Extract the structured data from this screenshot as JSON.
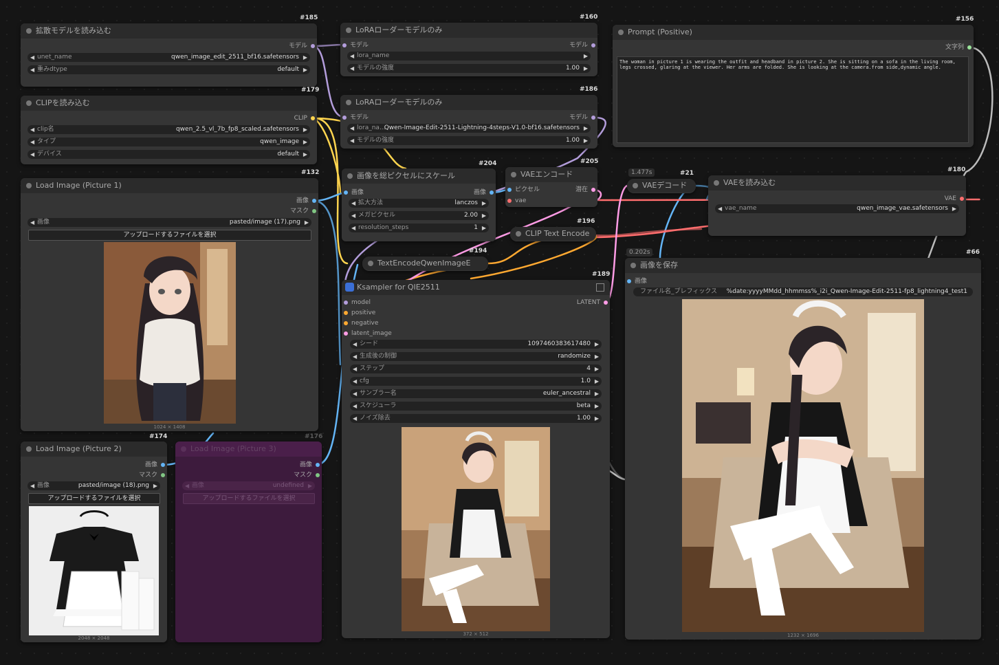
{
  "colors": {
    "model": "#b39ddb",
    "clip": "#ffd54f",
    "image": "#64b5f6",
    "mask": "#81c784",
    "latent": "#ff9ce6",
    "vae": "#ff6e6e",
    "conditioning": "#ffa931",
    "string": "#9be59b",
    "purple_node": "#3d1b3d"
  },
  "nodes": {
    "n185": {
      "id": "#185",
      "title": "拡散モデルを読み込む",
      "out": "モデル",
      "w1_label": "unet_name",
      "w1_value": "qwen_image_edit_2511_bf16.safetensors",
      "w2_label": "重みdtype",
      "w2_value": "default"
    },
    "n179": {
      "id": "#179",
      "title": "CLIPを読み込む",
      "out": "CLIP",
      "w1_label": "clip名",
      "w1_value": "qwen_2.5_vl_7b_fp8_scaled.safetensors",
      "w2_label": "タイプ",
      "w2_value": "qwen_image",
      "w3_label": "デバイス",
      "w3_value": "default"
    },
    "n132": {
      "id": "#132",
      "title": "Load Image (Picture 1)",
      "out1": "画像",
      "out2": "マスク",
      "w1_label": "画像",
      "w1_value": "pasted/image (17).png",
      "upload": "アップロードするファイルを選択",
      "dims": "1024 × 1408"
    },
    "n174": {
      "id": "#174",
      "title": "Load Image (Picture 2)",
      "out1": "画像",
      "out2": "マスク",
      "w1_label": "画像",
      "w1_value": "pasted/image (18).png",
      "upload": "アップロードするファイルを選択",
      "dims": "2048 × 2048"
    },
    "n176": {
      "id": "#176",
      "title": "Load Image (Picture 3)",
      "out1": "画像",
      "out2": "マスク",
      "w1_label": "画像",
      "w1_value": "undefined",
      "upload": "アップロードするファイルを選択"
    },
    "n160": {
      "id": "#160",
      "title": "LoRAローダーモデルのみ",
      "in": "モデル",
      "out": "モデル",
      "w1_label": "lora_name",
      "w1_value": "",
      "w2_label": "モデルの強度",
      "w2_value": "1.00"
    },
    "n186": {
      "id": "#186",
      "title": "LoRAローダーモデルのみ",
      "in": "モデル",
      "out": "モデル",
      "w1_label": "lora_na...",
      "w1_value": "Qwen-Image-Edit-2511-Lightning-4steps-V1.0-bf16.safetensors",
      "w2_label": "モデルの強度",
      "w2_value": "1.00"
    },
    "n204": {
      "id": "#204",
      "title": "画像を総ピクセルにスケール",
      "in": "画像",
      "out": "画像",
      "w1_label": "拡大方法",
      "w1_value": "lanczos",
      "w2_label": "メガピクセル",
      "w2_value": "2.00",
      "w3_label": "resolution_steps",
      "w3_value": "1"
    },
    "n205": {
      "id": "#205",
      "title": "VAEエンコード",
      "in1": "ピクセル",
      "in2": "vae",
      "out": "潜在"
    },
    "n196": {
      "id": "#196",
      "title": "CLIP Text Encode"
    },
    "n194": {
      "id": "#194",
      "title": "TextEncodeQwenImageE"
    },
    "n21": {
      "id": "#21",
      "title": "VAEデコード",
      "timing": "1.477s"
    },
    "n180": {
      "id": "#180",
      "title": "VAEを読み込む",
      "out": "VAE",
      "w1_label": "vae_name",
      "w1_value": "qwen_image_vae.safetensors"
    },
    "n156": {
      "id": "#156",
      "title": "Prompt (Positive)",
      "out": "文字列",
      "text": "The woman in picture 1 is wearing the outfit and headband in picture 2. She is sitting on a sofa in the living room, legs crossed, glaring at the viewer. Her arms are folded. She is looking at the camera.from side,dynamic angle."
    },
    "n189": {
      "id": "#189",
      "title": "Ksampler for QIE2511",
      "in1": "model",
      "in2": "positive",
      "in3": "negative",
      "in4": "latent_image",
      "out": "LATENT",
      "widgets": [
        {
          "label": "シード",
          "value": "1097460383617480"
        },
        {
          "label": "生成後の制御",
          "value": "randomize"
        },
        {
          "label": "ステップ",
          "value": "4"
        },
        {
          "label": "cfg",
          "value": "1.0"
        },
        {
          "label": "サンプラー名",
          "value": "euler_ancestral"
        },
        {
          "label": "スケジューラ",
          "value": "beta"
        },
        {
          "label": "ノイズ除去",
          "value": "1.00"
        }
      ],
      "dims": "372 × 512"
    },
    "n66": {
      "id": "#66",
      "title": "画像を保存",
      "timing": "0.202s",
      "in": "画像",
      "w1_label": "ファイル名_プレフィックス",
      "w1_value": "%date:yyyyMMdd_hhmmss%_i2i_Qwen-Image-Edit-2511-fp8_lightning4_test1",
      "dims": "1232 × 1696"
    }
  }
}
